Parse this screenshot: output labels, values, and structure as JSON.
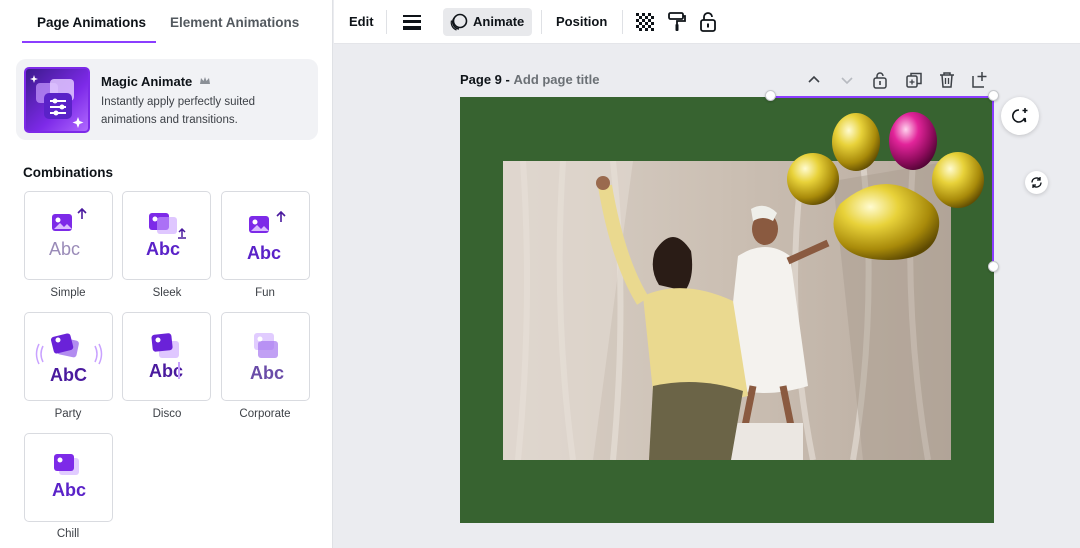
{
  "left_panel": {
    "tabs": [
      {
        "label": "Page Animations",
        "active": true
      },
      {
        "label": "Element Animations",
        "active": false
      }
    ],
    "magic_animate": {
      "title": "Magic Animate",
      "description": "Instantly apply perfectly suited animations and transitions.",
      "badge_icon": "crown-icon"
    },
    "section_title": "Combinations",
    "presets": [
      {
        "label": "Simple",
        "sample": "Abc"
      },
      {
        "label": "Sleek",
        "sample": "Abc"
      },
      {
        "label": "Fun",
        "sample": "Abc"
      },
      {
        "label": "Party",
        "sample": "AbC"
      },
      {
        "label": "Disco",
        "sample": "Abc"
      },
      {
        "label": "Corporate",
        "sample": "Abc"
      },
      {
        "label": "Chill",
        "sample": "Abc"
      }
    ]
  },
  "toolbar": {
    "edit_label": "Edit",
    "animate_label": "Animate",
    "position_label": "Position",
    "icons": [
      "line-weight-icon",
      "animate-icon",
      "transparency-icon",
      "paint-roller-icon",
      "lock-icon"
    ]
  },
  "page": {
    "number_label": "Page 9 -",
    "title_placeholder": "Add page title",
    "controls": [
      "chevron-up-icon",
      "chevron-down-icon",
      "lock-icon",
      "duplicate-icon",
      "trash-icon",
      "add-page-icon"
    ],
    "background_color": "#376330"
  },
  "colors": {
    "accent": "#8b3dff",
    "panel_bg": "#ffffff",
    "canvas_bg": "#ebecf0",
    "preset_purple": "#7d2ae8"
  }
}
